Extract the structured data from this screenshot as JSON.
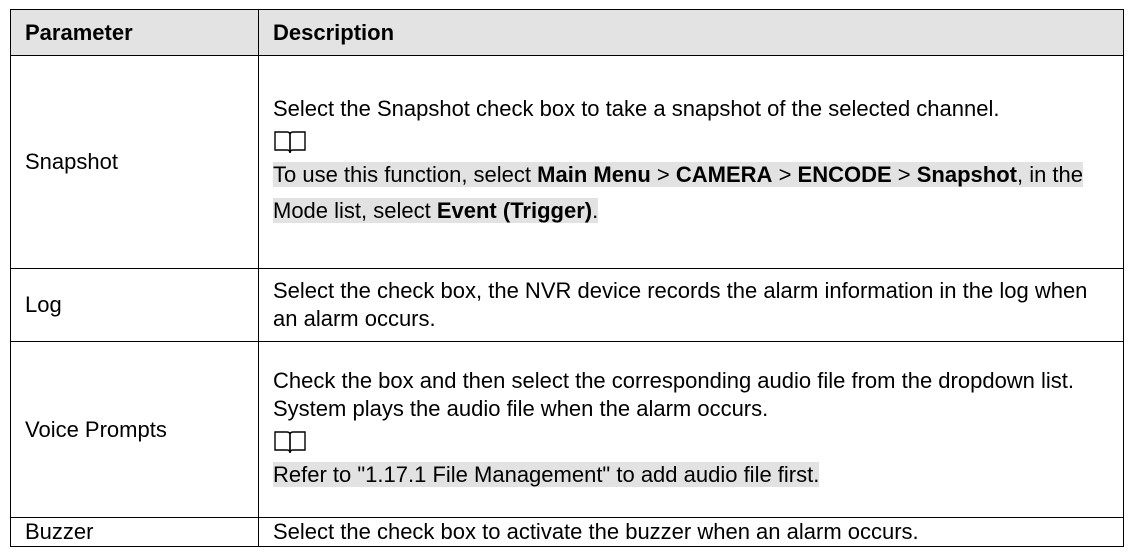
{
  "header": {
    "param": "Parameter",
    "desc": "Description"
  },
  "rows": {
    "snapshot": {
      "param": "Snapshot",
      "desc": "Select the Snapshot check box to take a snapshot of the selected channel.",
      "note": {
        "t1": "To use this function, select ",
        "b1": "Main Menu",
        "t2": " > ",
        "b2": "CAMERA",
        "t3": " > ",
        "b3": "ENCODE",
        "t4": " > ",
        "b4": "Snapshot",
        "t5": ", in the Mode list, select ",
        "b5": "Event (Trigger)",
        "t6": "."
      }
    },
    "log": {
      "param": "Log",
      "desc": "Select the check box, the NVR device records the alarm information in the log when an alarm occurs."
    },
    "voice": {
      "param": "Voice Prompts",
      "desc": "Check the box and then select the corresponding audio file from the dropdown list. System plays the audio file when the alarm occurs.",
      "note": "Refer to \"1.17.1 File Management\" to add audio file first."
    },
    "buzzer": {
      "param": "Buzzer",
      "desc": "Select the check box to activate the buzzer when an alarm occurs."
    }
  },
  "icons": {
    "note": "book-note-icon"
  }
}
